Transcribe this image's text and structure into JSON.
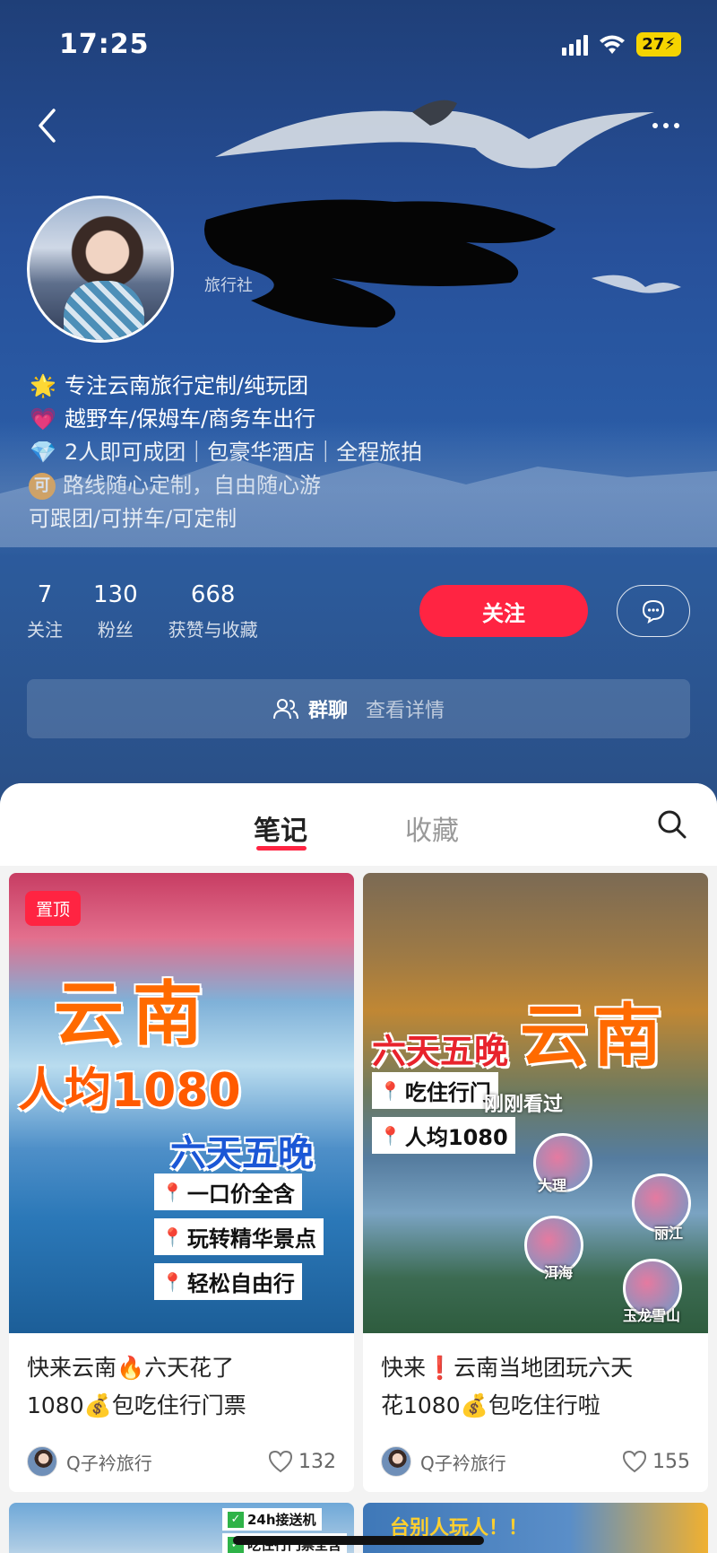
{
  "status": {
    "time": "17:25",
    "battery": "27"
  },
  "profile": {
    "sub_label": "旅行社",
    "bio": [
      {
        "icon": "star-icon",
        "emoji": "🌟",
        "text": "专注云南旅行定制/纯玩团"
      },
      {
        "icon": "pink-heart-icon",
        "emoji": "💗",
        "text": "越野车/保姆车/商务车出行"
      },
      {
        "icon": "diamond-icon",
        "emoji": "💎",
        "text": "2人即可成团｜包豪华酒店｜全程旅拍"
      },
      {
        "icon": "ke-badge-icon",
        "emoji": "可",
        "text": "路线随心定制，自由随心游"
      },
      {
        "icon": "",
        "emoji": "",
        "text": "可跟团/可拼车/可定制"
      }
    ],
    "stats": [
      {
        "num": "7",
        "label": "关注"
      },
      {
        "num": "130",
        "label": "粉丝"
      },
      {
        "num": "668",
        "label": "获赞与收藏"
      }
    ],
    "follow_label": "关注",
    "group_label": "群聊",
    "group_detail": "查看详情"
  },
  "tabs": {
    "notes": "笔记",
    "collect": "收藏"
  },
  "cards": [
    {
      "pin": "置顶",
      "cover_title": "云南",
      "cover_line2": "人均1080",
      "cover_line3": "六天五晚",
      "bullets": [
        "一口价全含",
        "玩转精华景点",
        "轻松自由行"
      ],
      "title_a": "快来云南🔥六天花了",
      "title_b": "1080💰包吃住行门票",
      "author": "Q子衿旅行",
      "likes": "132"
    },
    {
      "cover_title": "云南",
      "cover_line2": "六天五晚",
      "bullets": [
        "吃住行门",
        "人均1080"
      ],
      "seen": "刚刚看过",
      "places": [
        "大理",
        "丽江",
        "洱海",
        "玉龙雪山"
      ],
      "title_a": "快来❗云南当地团玩六天",
      "title_b": "花1080💰包吃住行啦",
      "author": "Q子衿旅行",
      "likes": "155"
    },
    {
      "tags": [
        "24h接送机",
        "吃住行门票全含"
      ]
    },
    {
      "text": "台别人玩人！！"
    }
  ]
}
